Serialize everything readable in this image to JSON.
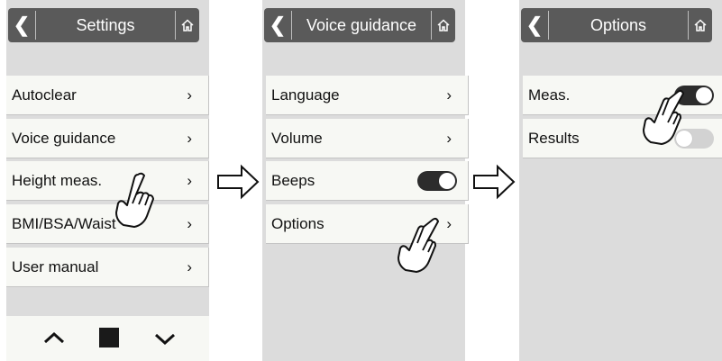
{
  "colors": {
    "header_bg": "#5a5a5a",
    "panel_bg": "#dcdcdc",
    "item_bg": "#f7f8f4",
    "toggle_on": "#2c2c2c",
    "toggle_off": "#d2d2d2"
  },
  "icons": {
    "back": "chevron-left-icon",
    "home": "home-icon",
    "item": "chevron-right-icon",
    "flow": "arrow-right-outline-icon",
    "pointer": "pointing-hand-icon"
  },
  "screens": {
    "settings": {
      "title": "Settings",
      "back_glyph": "❮",
      "items": [
        {
          "label": "Autoclear",
          "chevron": "›"
        },
        {
          "label": "Voice guidance",
          "chevron": "›"
        },
        {
          "label": "Height meas.",
          "chevron": "›"
        },
        {
          "label": "BMI/BSA/Waist",
          "chevron": "›"
        },
        {
          "label": "User manual",
          "chevron": "›"
        }
      ],
      "nav": {
        "up_glyph": "︿",
        "down_glyph": "﹀"
      }
    },
    "voice_guidance": {
      "title": "Voice guidance",
      "back_glyph": "❮",
      "items": [
        {
          "label": "Language",
          "chevron": "›"
        },
        {
          "label": "Volume",
          "chevron": "›"
        },
        {
          "label": "Beeps",
          "toggle": "on"
        },
        {
          "label": "Options",
          "chevron": "›"
        }
      ]
    },
    "options": {
      "title": "Options",
      "back_glyph": "❮",
      "items": [
        {
          "label": "Meas.",
          "toggle": "on"
        },
        {
          "label": "Results",
          "toggle": "off"
        }
      ]
    }
  }
}
